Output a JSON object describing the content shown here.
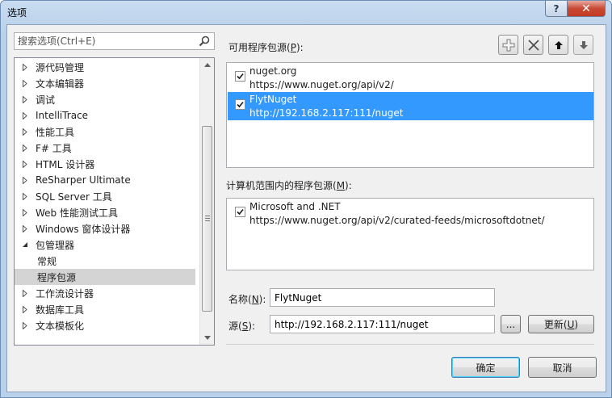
{
  "window": {
    "title": "选项",
    "help_label": "?",
    "close_label": "✕"
  },
  "search": {
    "placeholder": "搜索选项(Ctrl+E)"
  },
  "tree": {
    "items": [
      {
        "label": "源代码管理",
        "expander": "collapsed"
      },
      {
        "label": "文本编辑器",
        "expander": "collapsed"
      },
      {
        "label": "调试",
        "expander": "collapsed"
      },
      {
        "label": "IntelliTrace",
        "expander": "collapsed"
      },
      {
        "label": "性能工具",
        "expander": "collapsed"
      },
      {
        "label": "F# 工具",
        "expander": "collapsed"
      },
      {
        "label": "HTML 设计器",
        "expander": "collapsed"
      },
      {
        "label": "ReSharper Ultimate",
        "expander": "collapsed"
      },
      {
        "label": "SQL Server 工具",
        "expander": "collapsed"
      },
      {
        "label": "Web 性能测试工具",
        "expander": "collapsed"
      },
      {
        "label": "Windows 窗体设计器",
        "expander": "collapsed"
      },
      {
        "label": "包管理器",
        "expander": "expanded"
      },
      {
        "label": "常规",
        "expander": "none"
      },
      {
        "label": "程序包源",
        "expander": "none",
        "selected": true
      },
      {
        "label": "工作流设计器",
        "expander": "collapsed"
      },
      {
        "label": "数据库工具",
        "expander": "collapsed"
      },
      {
        "label": "文本模板化",
        "expander": "collapsed"
      }
    ]
  },
  "available_sources": {
    "label": "可用程序包源(",
    "accesskey": "P",
    "label_end": "):",
    "items": [
      {
        "name": "nuget.org",
        "url": "https://www.nuget.org/api/v2/",
        "checked": true,
        "selected": false
      },
      {
        "name": "FlytNuget",
        "url": "http://192.168.2.117:111/nuget",
        "checked": true,
        "selected": true
      }
    ]
  },
  "toolbar": {
    "add": "plus-icon",
    "remove": "x-icon",
    "move_up": "arrow-up-icon",
    "move_down": "arrow-down-icon"
  },
  "machine_sources": {
    "label": "计算机范围内的程序包源(",
    "accesskey": "M",
    "label_end": "):",
    "items": [
      {
        "name": "Microsoft and .NET",
        "url": "https://www.nuget.org/api/v2/curated-feeds/microsoftdotnet/",
        "checked": true
      }
    ]
  },
  "form": {
    "name_label": "名称(",
    "name_key": "N",
    "name_end": "):",
    "name_value": "FlytNuget",
    "source_label": "源(",
    "source_key": "S",
    "source_end": "):",
    "source_value": "http://192.168.2.117:111/nuget",
    "browse_label": "...",
    "update_label": "更新(",
    "update_key": "U",
    "update_end": ")"
  },
  "footer": {
    "ok_label": "确定",
    "cancel_label": "取消"
  },
  "colors": {
    "selection": "#3399ff",
    "tree_selection": "#d4d4d4"
  }
}
